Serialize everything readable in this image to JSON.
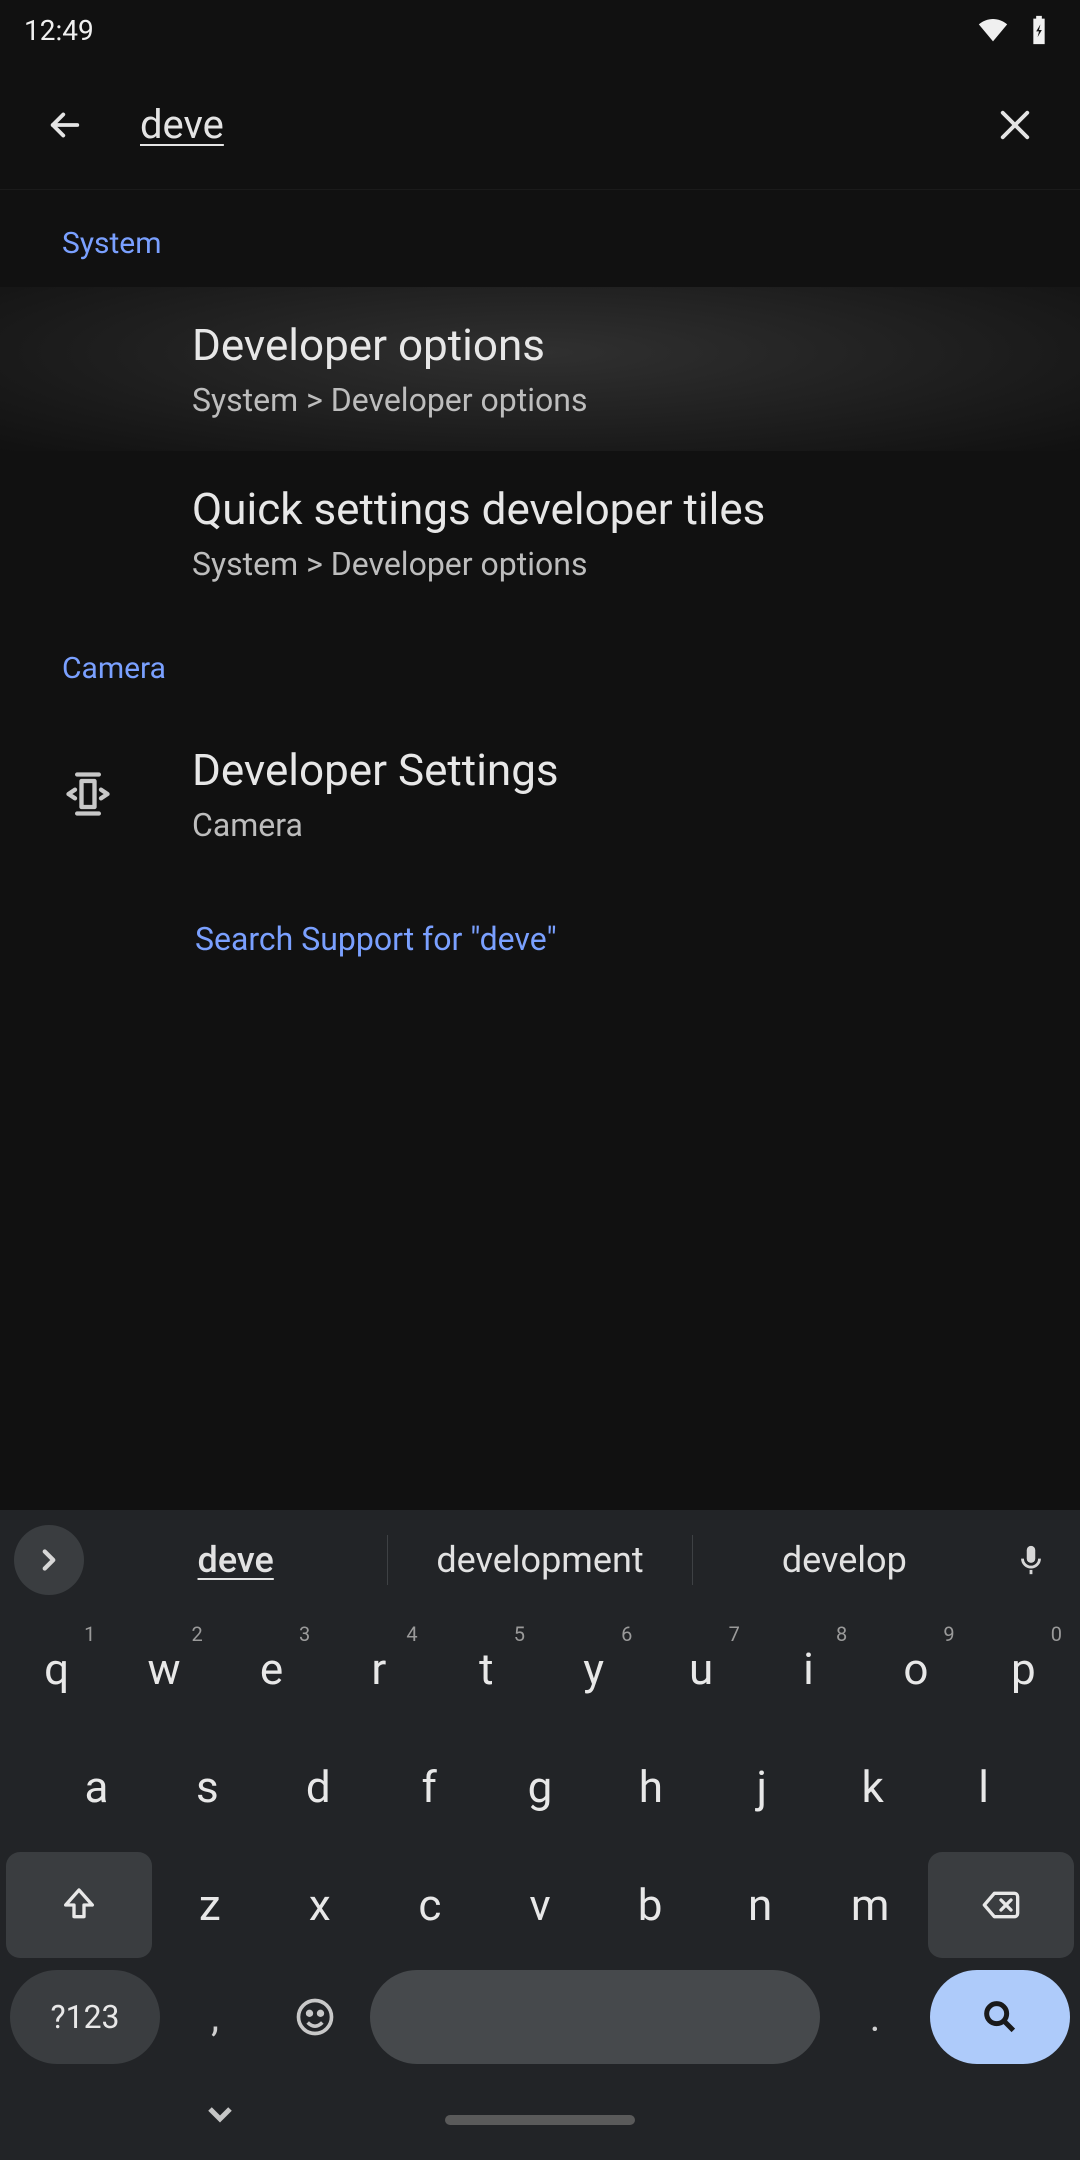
{
  "status": {
    "time": "12:49"
  },
  "search": {
    "value": "deve"
  },
  "sections": [
    {
      "label": "System",
      "results": [
        {
          "title": "Developer options",
          "subtitle": "System > Developer options"
        },
        {
          "title": "Quick settings developer tiles",
          "subtitle": "System > Developer options"
        }
      ]
    },
    {
      "label": "Camera",
      "results": [
        {
          "title": "Developer Settings",
          "subtitle": "Camera"
        }
      ]
    }
  ],
  "support_search": "Search Support for \"deve\"",
  "keyboard": {
    "suggestions": [
      "deve",
      "development",
      "develop"
    ],
    "row1": [
      {
        "k": "q",
        "n": "1"
      },
      {
        "k": "w",
        "n": "2"
      },
      {
        "k": "e",
        "n": "3"
      },
      {
        "k": "r",
        "n": "4"
      },
      {
        "k": "t",
        "n": "5"
      },
      {
        "k": "y",
        "n": "6"
      },
      {
        "k": "u",
        "n": "7"
      },
      {
        "k": "i",
        "n": "8"
      },
      {
        "k": "o",
        "n": "9"
      },
      {
        "k": "p",
        "n": "0"
      }
    ],
    "row2": [
      "a",
      "s",
      "d",
      "f",
      "g",
      "h",
      "j",
      "k",
      "l"
    ],
    "row3": [
      "z",
      "x",
      "c",
      "v",
      "b",
      "n",
      "m"
    ],
    "sym_label": "?123",
    "comma": ",",
    "period": "."
  }
}
